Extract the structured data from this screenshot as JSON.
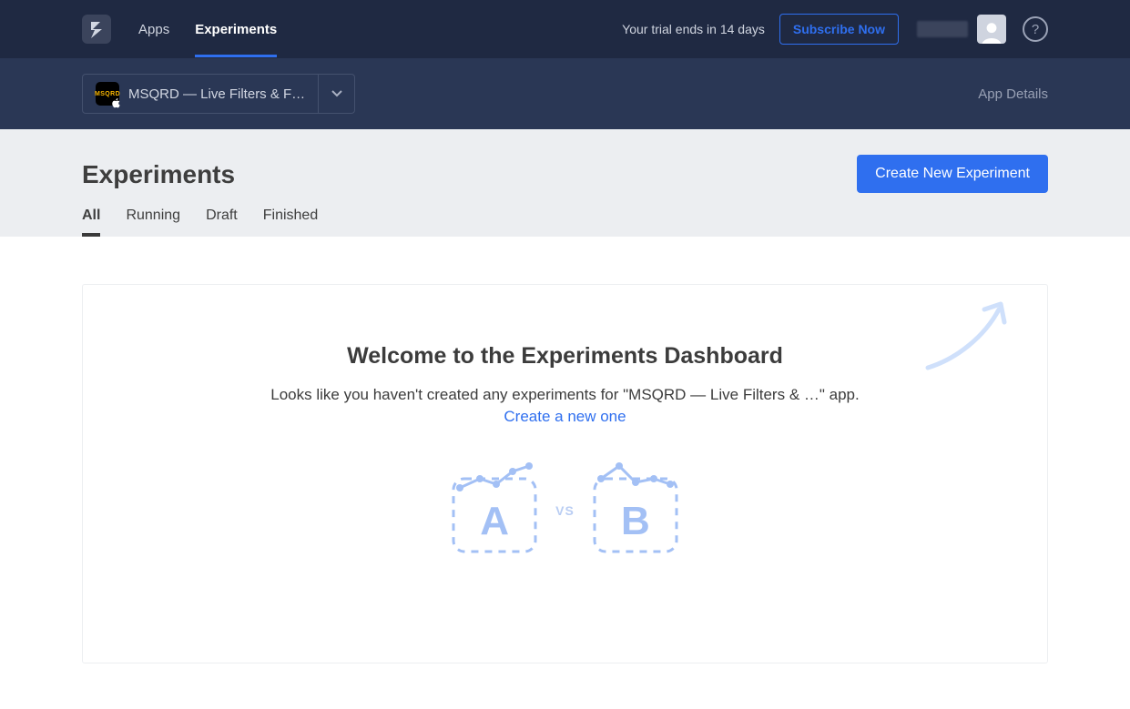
{
  "topbar": {
    "nav": {
      "apps": "Apps",
      "experiments": "Experiments"
    },
    "trial_text": "Your trial ends in 14 days",
    "subscribe_label": "Subscribe Now",
    "help_glyph": "?"
  },
  "subbar": {
    "app_icon_text": "MSQRD",
    "app_name": "MSQRD — Live Filters & F…",
    "app_details": "App Details"
  },
  "midstrip": {
    "title": "Experiments",
    "create_label": "Create New Experiment",
    "tabs": {
      "all": "All",
      "running": "Running",
      "draft": "Draft",
      "finished": "Finished"
    }
  },
  "dash": {
    "heading": "Welcome to the Experiments Dashboard",
    "sub": "Looks like you haven't created any experiments for \"MSQRD — Live Filters & …\" app.",
    "link": "Create a new one",
    "letter_a": "A",
    "letter_b": "B",
    "vs": "VS"
  }
}
